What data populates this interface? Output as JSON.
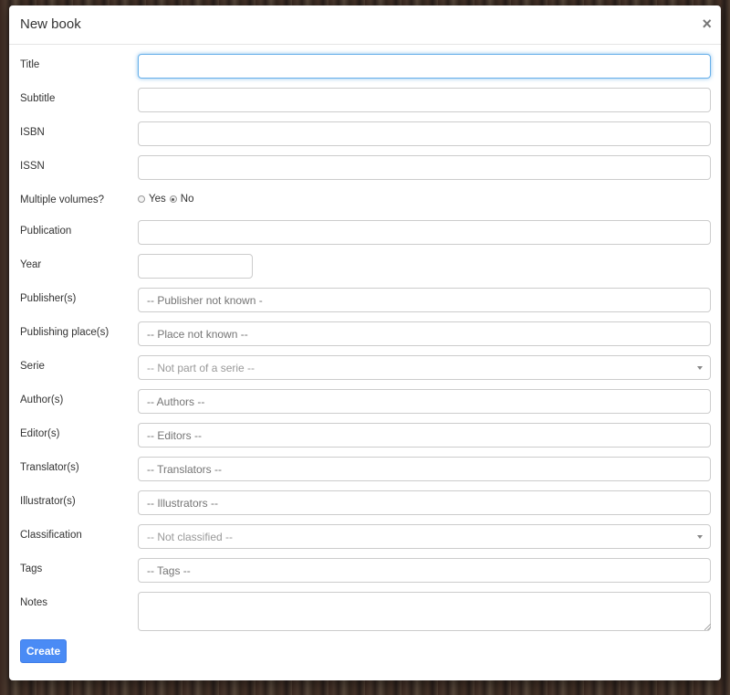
{
  "modal": {
    "title": "New book",
    "close_symbol": "×",
    "create_label": "Create"
  },
  "fields": {
    "title": {
      "label": "Title",
      "value": ""
    },
    "subtitle": {
      "label": "Subtitle",
      "value": ""
    },
    "isbn": {
      "label": "ISBN",
      "value": ""
    },
    "issn": {
      "label": "ISSN",
      "value": ""
    },
    "multiple_volumes": {
      "label": "Multiple volumes?",
      "options": [
        "Yes",
        "No"
      ],
      "selected": "No"
    },
    "publication": {
      "label": "Publication",
      "value": ""
    },
    "year": {
      "label": "Year",
      "value": ""
    },
    "publishers": {
      "label": "Publisher(s)",
      "placeholder": "-- Publisher not known -"
    },
    "publishing_places": {
      "label": "Publishing place(s)",
      "placeholder": "-- Place not known --"
    },
    "serie": {
      "label": "Serie",
      "placeholder": "-- Not part of a serie --"
    },
    "authors": {
      "label": "Author(s)",
      "placeholder": "-- Authors --"
    },
    "editors": {
      "label": "Editor(s)",
      "placeholder": "-- Editors --"
    },
    "translators": {
      "label": "Translator(s)",
      "placeholder": "-- Translators --"
    },
    "illustrators": {
      "label": "Illustrator(s)",
      "placeholder": "-- Illustrators --"
    },
    "classification": {
      "label": "Classification",
      "placeholder": "-- Not classified --"
    },
    "tags": {
      "label": "Tags",
      "placeholder": "-- Tags --"
    },
    "notes": {
      "label": "Notes",
      "value": ""
    }
  }
}
